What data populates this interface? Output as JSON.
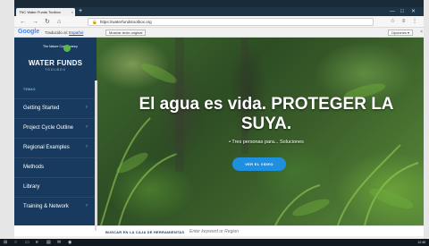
{
  "browser": {
    "tab_title": "TNC Water Funds Toolbox",
    "tab_close": "×",
    "new_tab": "+",
    "window_controls": [
      "—",
      "□",
      "✕"
    ],
    "nav_icons": [
      "back-icon",
      "forward-icon",
      "refresh-icon",
      "home-icon"
    ],
    "nav_glyphs": [
      "←",
      "→",
      "↻",
      "⌂"
    ],
    "url": "https://waterfundstoolbox.org",
    "lock_glyph": "🔒",
    "toolbar_glyphs": "☆ ≡ ⋮"
  },
  "translate_bar": {
    "logo": "Google",
    "translated_to": "Traducido al:",
    "language": "Español",
    "show_original": "Mostrar texto original",
    "options": "Opciones ▾",
    "close": "×"
  },
  "sidebar": {
    "org_logo_text": "The Nature Conservancy",
    "brand": "WATER FUNDS",
    "brand_sub": "TOOLBOX",
    "section_label": "TEMAS",
    "items": [
      {
        "label": "Getting Started",
        "chevron": "›"
      },
      {
        "label": "Project Cycle Outline",
        "chevron": "›"
      },
      {
        "label": "Regional Examples",
        "chevron": "›"
      },
      {
        "label": "Methods",
        "chevron": ""
      },
      {
        "label": "Library",
        "chevron": ""
      },
      {
        "label": "Training & Network",
        "chevron": "›"
      }
    ]
  },
  "hero": {
    "title": "El agua es vida. PROTEGER LA SUYA.",
    "subtitle": "• Tres personas para... Soluciones",
    "button": "VER EL VIDEO"
  },
  "search": {
    "label": "BUSCAR EN LA CAJA DE HERRAMIENTAS",
    "placeholder": "Enter keyword or Region"
  },
  "taskbar": {
    "items": [
      "⊞",
      "○",
      "▭",
      "e",
      "▤",
      "✉",
      "◉"
    ],
    "clock": "12:45"
  },
  "colors": {
    "sidebar": "#183a5e",
    "accent_button": "#1f8fe0",
    "tab_strip": "#1d3547"
  }
}
